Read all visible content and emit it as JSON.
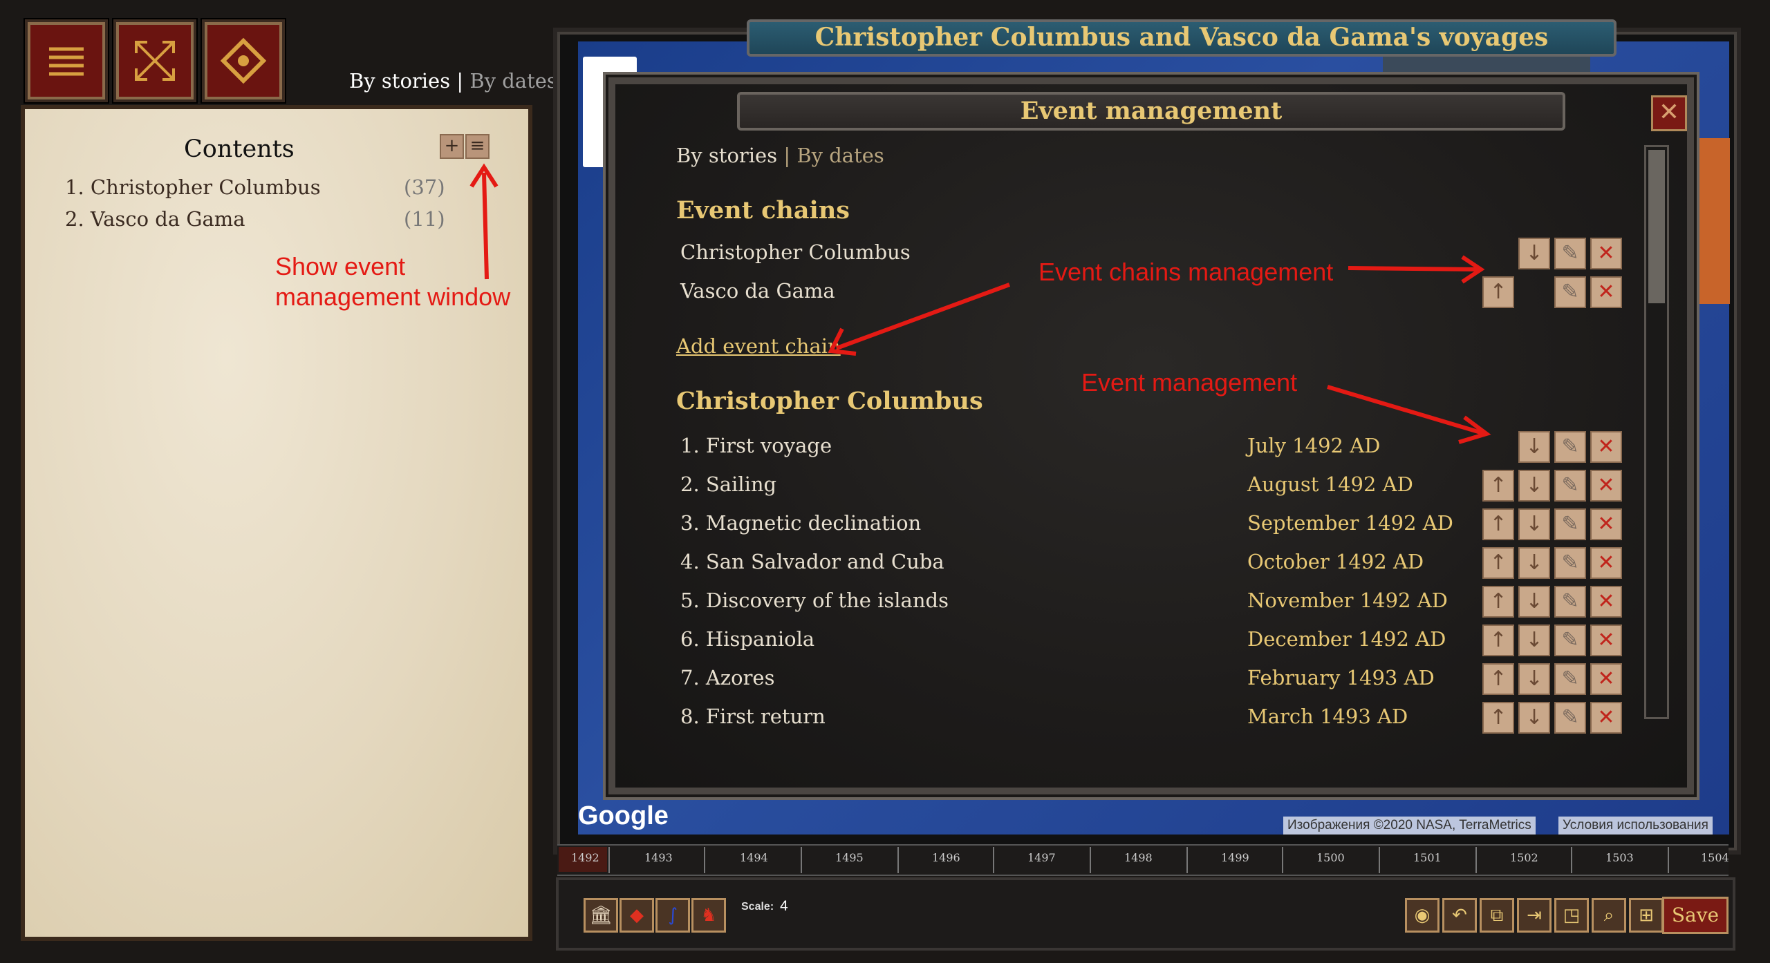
{
  "top_toggle": {
    "by_stories": "By stories",
    "separator": "|",
    "by_dates": "By dates"
  },
  "sidebar": {
    "title": "Contents",
    "items": [
      {
        "label": "1. Christopher Columbus",
        "count": "(37)"
      },
      {
        "label": "2. Vasco da Gama",
        "count": "(11)"
      }
    ]
  },
  "annotations": {
    "show_event_line1": "Show event",
    "show_event_line2": "management window",
    "chains_mgmt": "Event chains management",
    "event_mgmt": "Event management"
  },
  "map": {
    "title": "Christopher Columbus and Vasco da Gama's voyages",
    "google": "Google",
    "attribution": "Изображения ©2020 NASA, TerraMetrics",
    "terms": "Условия использования"
  },
  "modal": {
    "title": "Event management",
    "close_glyph": "✕",
    "toggle": {
      "by_stories": "By stories",
      "separator": "|",
      "by_dates": "By dates"
    },
    "chains_heading": "Event chains",
    "chains": [
      {
        "label": "Christopher Columbus"
      },
      {
        "label": "Vasco da Gama"
      }
    ],
    "add_chain": "Add event chain",
    "events_heading": "Christopher Columbus",
    "events": [
      {
        "label": "1. First voyage",
        "date": "July 1492 AD"
      },
      {
        "label": "2. Sailing",
        "date": "August 1492 AD"
      },
      {
        "label": "3. Magnetic declination",
        "date": "September 1492 AD"
      },
      {
        "label": "4. San Salvador and Cuba",
        "date": "October 1492 AD"
      },
      {
        "label": "5. Discovery of the islands",
        "date": "November 1492 AD"
      },
      {
        "label": "6. Hispaniola",
        "date": "December 1492 AD"
      },
      {
        "label": "7. Azores",
        "date": "February 1493 AD"
      },
      {
        "label": "8. First return",
        "date": "March 1493 AD"
      }
    ]
  },
  "timeline": {
    "years": [
      "1492",
      "1493",
      "1494",
      "1495",
      "1496",
      "1497",
      "1498",
      "1499",
      "1500",
      "1501",
      "1502",
      "1503",
      "1504"
    ]
  },
  "toolbar": {
    "scale_label": "Scale:",
    "scale_value": "4",
    "save": "Save"
  }
}
